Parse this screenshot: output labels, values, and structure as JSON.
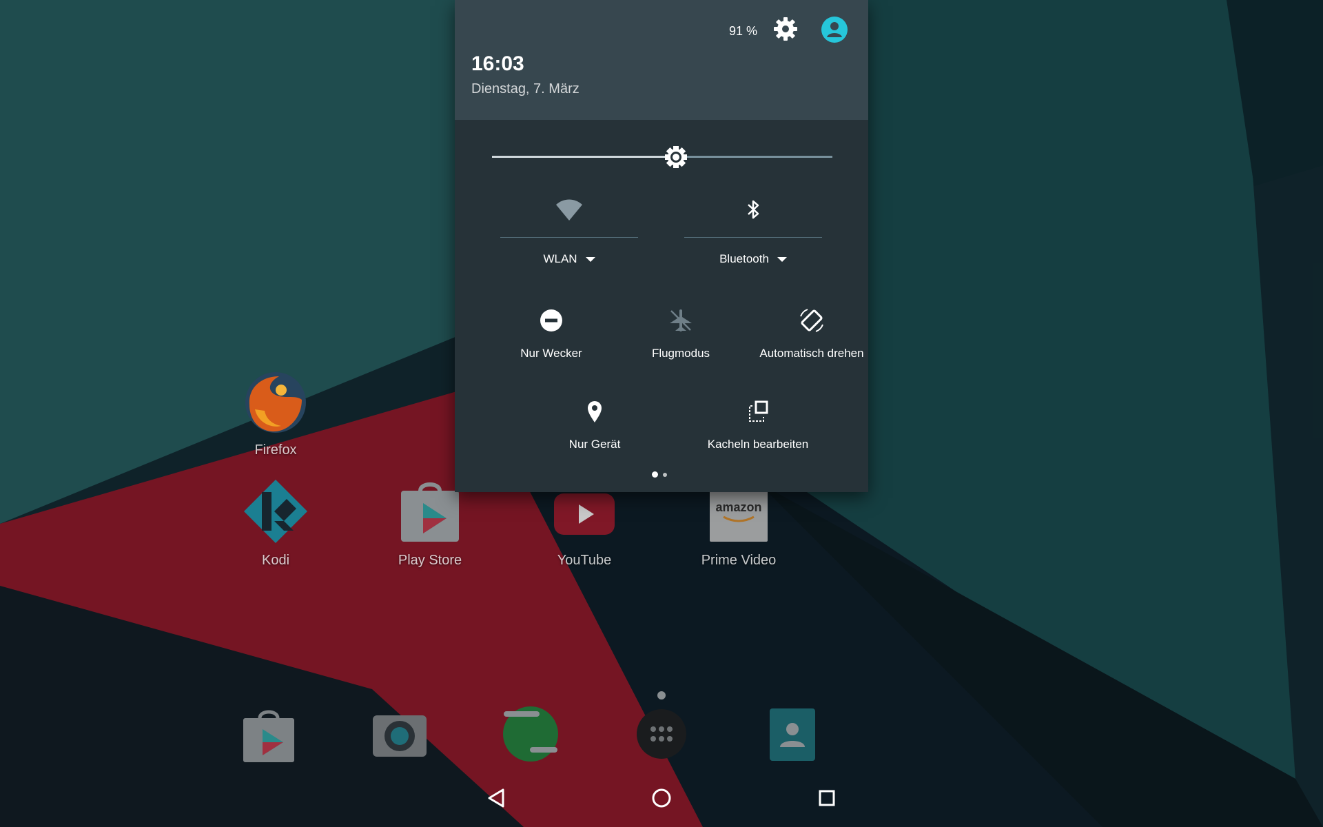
{
  "status": {
    "battery": "91 %",
    "time": "16:03",
    "date": "Dienstag, 7. März"
  },
  "brightness": {
    "level": 0.54
  },
  "quick_settings": {
    "wifi_label": "WLAN",
    "bluetooth_label": "Bluetooth",
    "tiles": [
      "Nur Wecker",
      "Flugmodus",
      "Automatisch drehen",
      "Nur Gerät",
      "Kacheln bearbeiten"
    ],
    "pages": 2,
    "current_page": 1
  },
  "home_apps": [
    "Firefox",
    "Kodi",
    "Play Store",
    "YouTube",
    "Prime Video"
  ],
  "dock_apps": [
    "play-store-icon",
    "camera-icon",
    "hangouts-icon",
    "app-drawer-icon",
    "contacts-icon"
  ],
  "colors": {
    "shade": "#263238",
    "header": "#37474f",
    "accent": "#26c6da",
    "wallpaper_red": "#a81f33",
    "wallpaper_teal": "#2d6d70"
  }
}
